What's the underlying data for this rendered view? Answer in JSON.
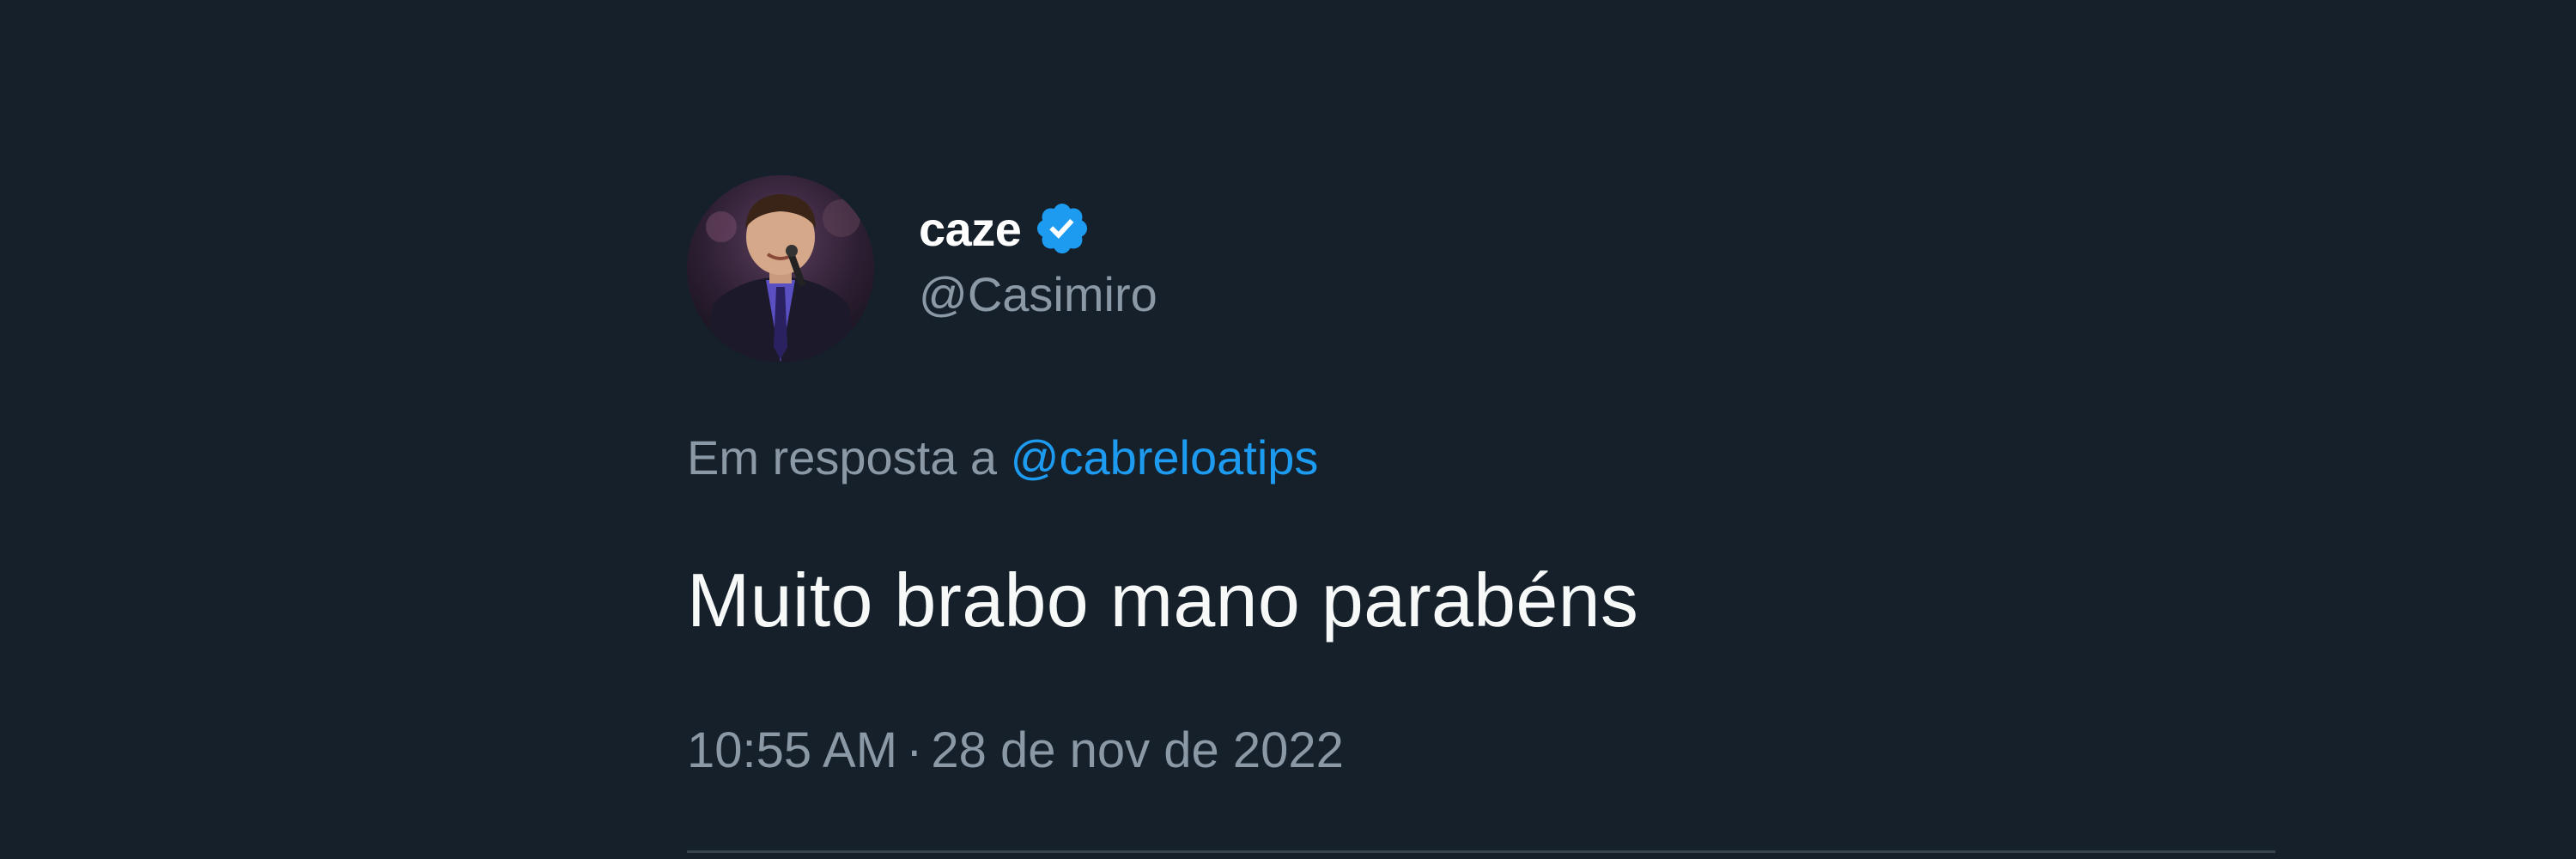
{
  "tweet": {
    "author": {
      "display_name": "caze",
      "handle": "@Casimiro",
      "verified": true,
      "avatar_icon": "user-avatar-photo"
    },
    "reply": {
      "prefix": "Em resposta a",
      "mention": "@cabreloatips"
    },
    "text": "Muito brabo mano parabéns",
    "meta": {
      "time": "10:55 AM",
      "separator": "·",
      "date": "28 de nov de 2022"
    }
  },
  "colors": {
    "background": "#15202b",
    "primary_text": "#f7f9f9",
    "secondary_text": "#8b98a5",
    "accent": "#1d9bf0",
    "divider": "#38444d"
  }
}
